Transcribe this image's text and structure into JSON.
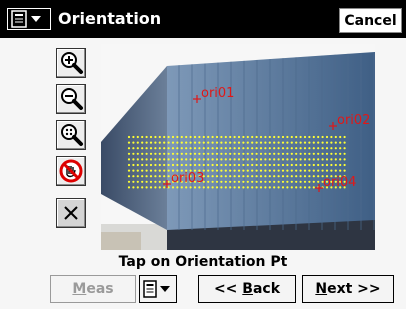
{
  "window": {
    "title": "Orientation",
    "cancel_label": "Cancel"
  },
  "tools": [
    {
      "name": "zoom-in-icon"
    },
    {
      "name": "zoom-out-icon"
    },
    {
      "name": "zoom-fit-icon"
    },
    {
      "name": "no-pan-icon"
    },
    {
      "name": "close-icon"
    }
  ],
  "photo": {
    "points": [
      {
        "label": "ori01"
      },
      {
        "label": "ori02"
      },
      {
        "label": "ori03"
      },
      {
        "label": "ori04"
      }
    ],
    "dot_color": "#ffff33",
    "label_color": "#e01818"
  },
  "instruction": "Tap on Orientation Pt",
  "buttons": {
    "meas": {
      "prefix": "",
      "accel": "M",
      "rest": "eas"
    },
    "back": {
      "prefix": "<< ",
      "accel": "B",
      "rest": "ack"
    },
    "next": {
      "prefix": "",
      "accel": "N",
      "rest": "ext >>"
    }
  }
}
